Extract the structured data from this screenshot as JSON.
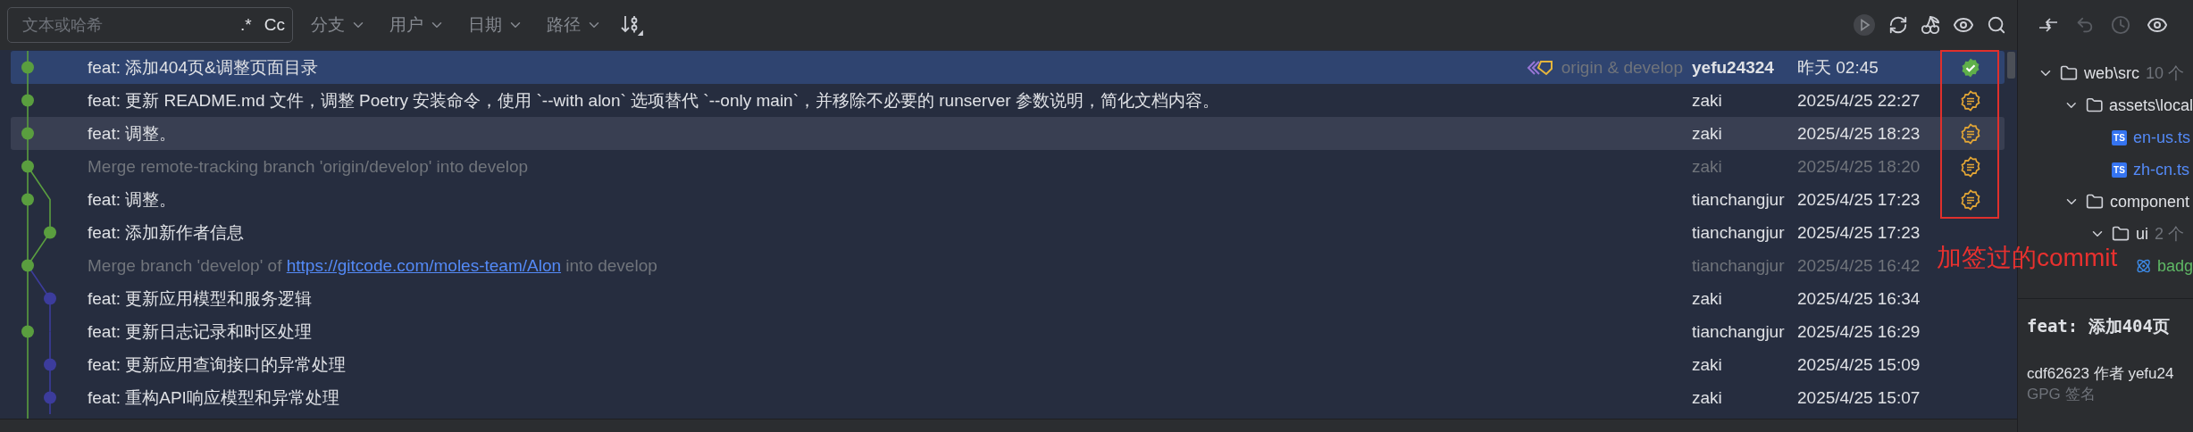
{
  "toolbar": {
    "search": {
      "placeholder": "文本或哈希"
    },
    "toggles": [
      ".*",
      "Cc"
    ],
    "filters": [
      "分支",
      "用户",
      "日期",
      "路径"
    ]
  },
  "commits": [
    {
      "message": "feat: 添加404页&调整页面目录",
      "refs": "origin & develop",
      "author": "yefu24324",
      "date": "昨天 02:45",
      "kind": "commit",
      "side_branch": false,
      "color": "#5a9e3f",
      "selected": true,
      "hovered": false,
      "own": true,
      "signed": true,
      "verified": true
    },
    {
      "message": "feat: 更新 README.md 文件，调整 Poetry 安装命令，使用 `--with alon` 选项替代 `--only main`，并移除不必要的 runserver 参数说明，简化文档内容。",
      "author": "zaki",
      "date": "2025/4/25 22:27",
      "kind": "commit",
      "side_branch": false,
      "color": "#5a9e3f",
      "selected": false,
      "hovered": false,
      "own": false,
      "signed": true,
      "verified": false
    },
    {
      "message": "feat: 调整。",
      "author": "zaki",
      "date": "2025/4/25 18:23",
      "kind": "commit",
      "side_branch": false,
      "color": "#5a9e3f",
      "selected": false,
      "hovered": true,
      "own": false,
      "signed": true,
      "verified": false
    },
    {
      "message": "Merge remote-tracking branch 'origin/develop' into develop",
      "author": "zaki",
      "date": "2025/4/25 18:20",
      "kind": "merge",
      "side_branch": false,
      "color": "#5a9e3f",
      "selected": false,
      "hovered": false,
      "own": false,
      "signed": true,
      "verified": false
    },
    {
      "message": "feat: 调整。",
      "author": "tianchangjur",
      "date": "2025/4/25 17:23",
      "kind": "commit",
      "side_branch": false,
      "color": "#5a9e3f",
      "selected": false,
      "hovered": false,
      "own": false,
      "signed": true,
      "verified": false
    },
    {
      "message": "feat: 添加新作者信息",
      "author": "tianchangjur",
      "date": "2025/4/25 17:23",
      "kind": "commit",
      "side_branch": true,
      "color": "#5a9e3f",
      "selected": false,
      "hovered": false,
      "own": false,
      "signed": false
    },
    {
      "message": "Merge branch 'develop' of ",
      "link": "https://gitcode.com/moles-team/Alon",
      "message_end": " into develop",
      "author": "tianchangjur",
      "date": "2025/4/25 16:42",
      "kind": "merge",
      "side_branch": false,
      "color": "#5a9e3f",
      "selected": false,
      "hovered": false,
      "own": false,
      "signed": false
    },
    {
      "message": "feat: 更新应用模型和服务逻辑",
      "author": "zaki",
      "date": "2025/4/25 16:34",
      "kind": "commit",
      "side_branch": true,
      "color": "#3c3c9c",
      "selected": false,
      "hovered": false,
      "own": false,
      "signed": false
    },
    {
      "message": "feat: 更新日志记录和时区处理",
      "author": "tianchangjur",
      "date": "2025/4/25 16:29",
      "kind": "commit",
      "color": "#5a9e3f",
      "selected": false,
      "hovered": false,
      "own": false,
      "signed": false
    },
    {
      "message": "feat: 更新应用查询接口的异常处理",
      "author": "zaki",
      "date": "2025/4/25 15:09",
      "kind": "commit",
      "side_branch": true,
      "color": "#3c3c9c",
      "selected": false,
      "hovered": false,
      "own": false,
      "signed": false
    },
    {
      "message": "feat: 重构API响应模型和异常处理",
      "author": "zaki",
      "date": "2025/4/25 15:07",
      "kind": "commit",
      "side_branch": true,
      "color": "#3c3c9c",
      "selected": false,
      "hovered": false,
      "own": false,
      "signed": false
    }
  ],
  "annotation": "加签过的commit",
  "side_panel": {
    "tree": [
      {
        "name": "web\\src",
        "count": "10 个",
        "kind": "folder",
        "expanded": true,
        "children": [
          {
            "name": "assets\\local",
            "kind": "folder",
            "expanded": true,
            "children": [
              {
                "name": "en-us.ts",
                "kind": "ts",
                "badge": "TS",
                "added": false
              },
              {
                "name": "zh-cn.ts",
                "kind": "ts",
                "badge": "TS",
                "added": false
              }
            ]
          },
          {
            "name": "component",
            "kind": "folder",
            "expanded": true,
            "children": [
              {
                "name": "ui",
                "count": "2 个",
                "kind": "folder",
                "expanded": true,
                "children": [
                  {
                    "name": "badg",
                    "kind": "react",
                    "added": true
                  }
                ]
              }
            ]
          }
        ]
      }
    ],
    "details": {
      "title": "feat: 添加404页",
      "meta": "cdf62623 作者 yefu24",
      "signature": "GPG 签名"
    }
  }
}
